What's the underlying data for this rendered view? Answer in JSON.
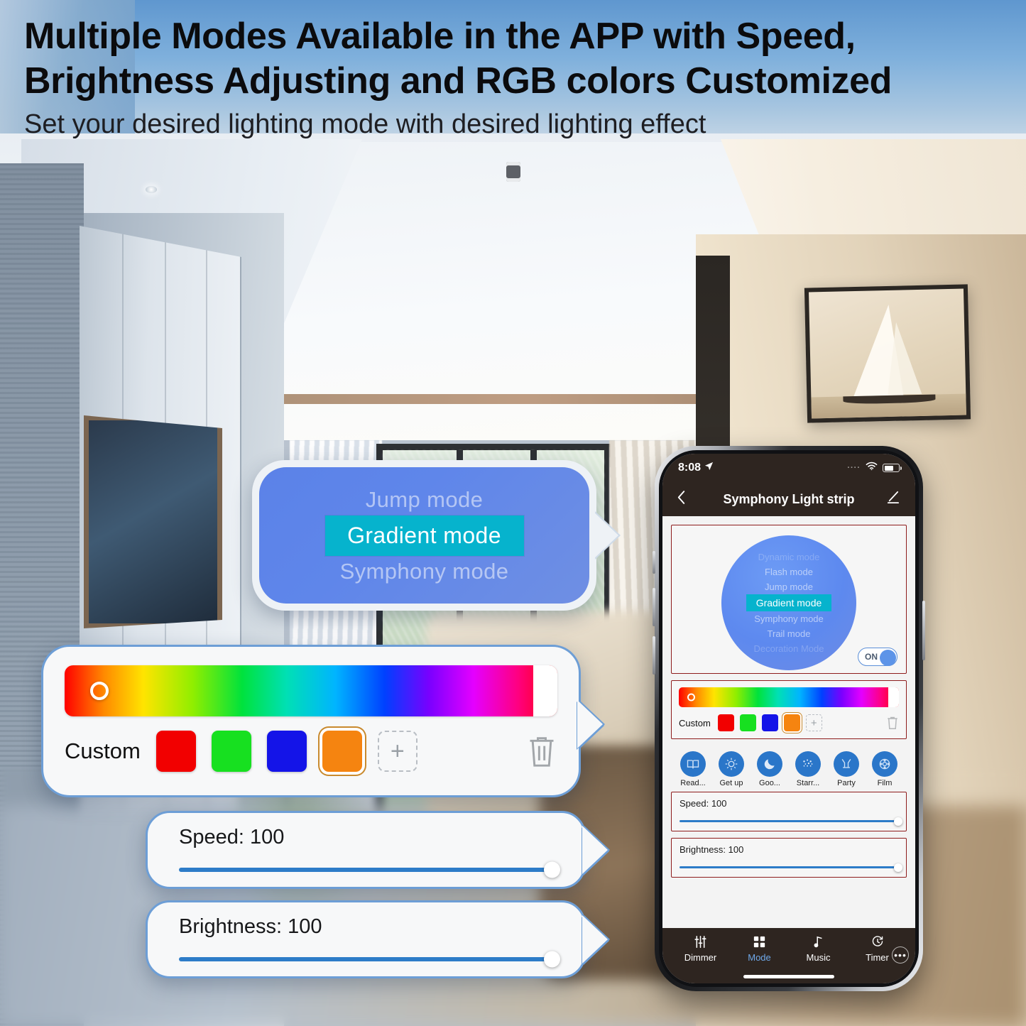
{
  "headings": {
    "title_line1": "Multiple Modes Available in the APP with Speed,",
    "title_line2": "Brightness Adjusting and RGB colors Customized",
    "subtitle": "Set your desired lighting mode with desired lighting effect"
  },
  "mode_callout": {
    "rows": [
      {
        "label": "Jump mode",
        "selected": false
      },
      {
        "label": "Gradient mode",
        "selected": true
      },
      {
        "label": "Symphony mode",
        "selected": false
      }
    ],
    "selected_color": "#06b3cd",
    "panel_color": "#5f86ea"
  },
  "color_callout": {
    "custom_label": "Custom",
    "swatches": [
      {
        "name": "red",
        "color": "#f20000",
        "active": false
      },
      {
        "name": "green",
        "color": "#17e020",
        "active": false
      },
      {
        "name": "blue",
        "color": "#1414e8",
        "active": false
      },
      {
        "name": "orange",
        "color": "#f58410",
        "active": true
      }
    ],
    "add_label": "+",
    "delete_icon": "trash-icon",
    "hue_knob_icon": "hue-handle-icon"
  },
  "speed_callout": {
    "label": "Speed: 100",
    "value": 100
  },
  "brightness_callout": {
    "label": "Brightness: 100",
    "value": 100
  },
  "phone": {
    "status": {
      "time": "8:08",
      "location_icon": "location-arrow-icon",
      "signal_dots": "····",
      "wifi_icon": "wifi-icon",
      "battery_icon": "battery-icon"
    },
    "nav": {
      "back_icon": "chevron-left-icon",
      "title": "Symphony Light strip",
      "edit_icon": "pencil-icon"
    },
    "mode_wheel": {
      "rows": [
        {
          "label": "Dynamic mode",
          "state": "faint"
        },
        {
          "label": "Flash mode",
          "state": "dim"
        },
        {
          "label": "Jump mode",
          "state": "dim"
        },
        {
          "label": "Gradient mode",
          "state": "selected"
        },
        {
          "label": "Symphony mode",
          "state": "dim"
        },
        {
          "label": "Trail mode",
          "state": "dim"
        },
        {
          "label": "Decoration Mode",
          "state": "faint"
        }
      ],
      "toggle_label": "ON",
      "toggle_on": true
    },
    "color": {
      "custom_label": "Custom",
      "swatches": [
        {
          "name": "red",
          "color": "#f20000",
          "active": false
        },
        {
          "name": "green",
          "color": "#17e020",
          "active": false
        },
        {
          "name": "blue",
          "color": "#1414e8",
          "active": false
        },
        {
          "name": "orange",
          "color": "#f58410",
          "active": true
        }
      ],
      "add_label": "+",
      "delete_icon": "trash-icon"
    },
    "scenes": [
      {
        "label": "Read...",
        "icon": "reading-icon"
      },
      {
        "label": "Get up",
        "icon": "get-up-icon"
      },
      {
        "label": "Goo...",
        "icon": "moon-icon"
      },
      {
        "label": "Starr...",
        "icon": "stars-icon"
      },
      {
        "label": "Party",
        "icon": "party-icon"
      },
      {
        "label": "Film",
        "icon": "film-icon"
      }
    ],
    "speed": {
      "label": "Speed: 100",
      "value": 100
    },
    "brightness": {
      "label": "Brightness: 100",
      "value": 100
    },
    "tabs": [
      {
        "label": "Dimmer",
        "icon": "sliders-icon",
        "active": false
      },
      {
        "label": "Mode",
        "icon": "grid-icon",
        "active": true
      },
      {
        "label": "Music",
        "icon": "music-note-icon",
        "active": false
      },
      {
        "label": "Timer",
        "icon": "timer-icon",
        "active": false
      }
    ],
    "more_icon": "ellipsis-icon",
    "accent_color": "#6fa8e8",
    "chrome_color": "#2e2520",
    "highlight_border": "#8e1c1c"
  }
}
